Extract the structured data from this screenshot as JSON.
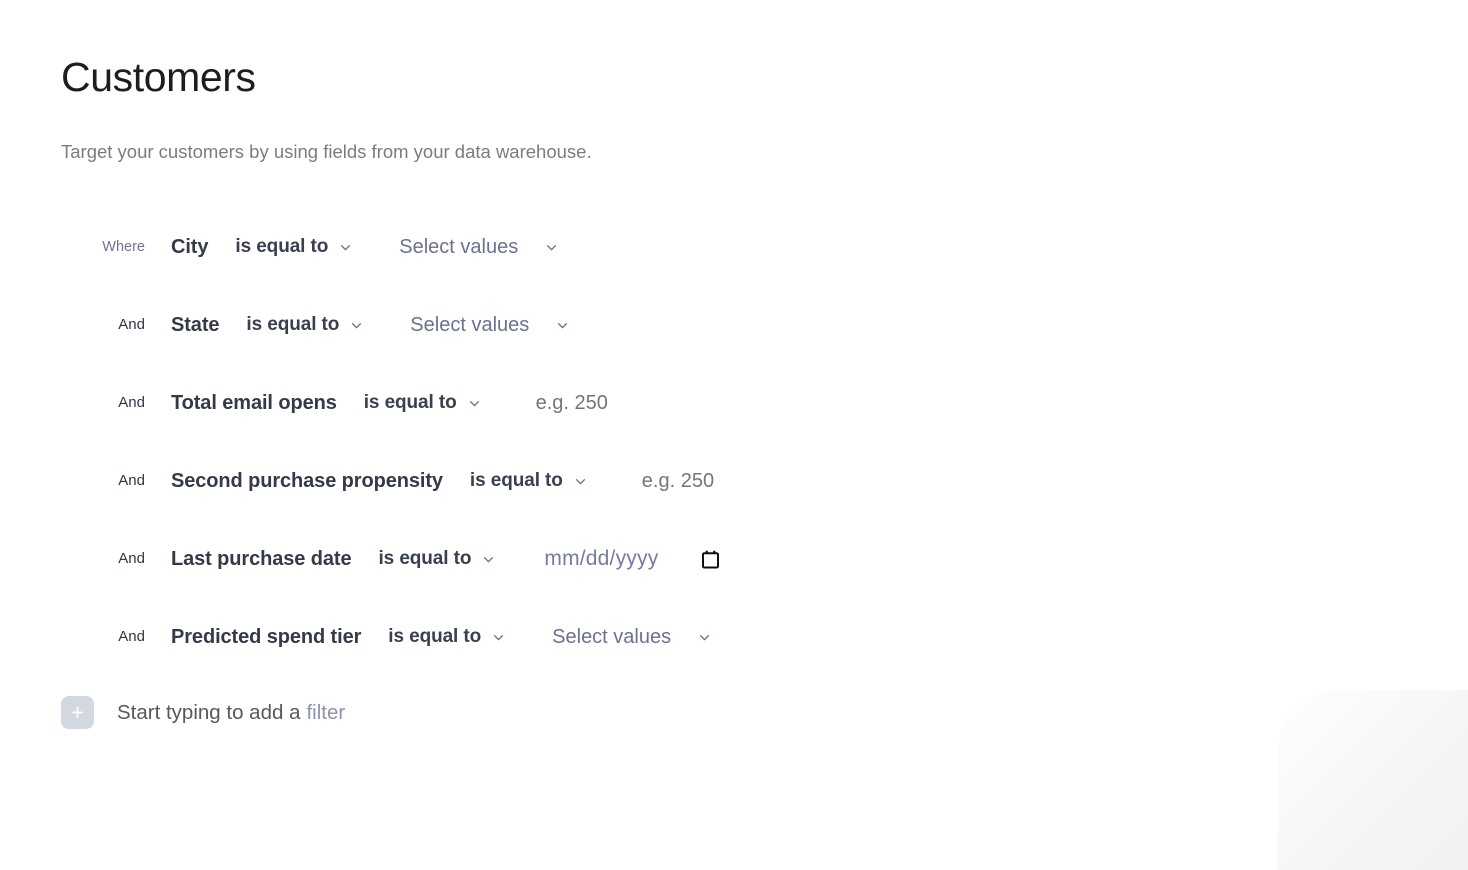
{
  "page": {
    "title": "Customers",
    "subtitle": "Target your customers by using fields from your data warehouse."
  },
  "colors": {
    "title": "#1c1c22",
    "subtitle": "#7b7b83",
    "field_name": "#343a48",
    "operator": "#3a4050",
    "where_label": "#6f7490",
    "and_label": "#2f3542",
    "select_placeholder": "#6b7190",
    "number_placeholder": "#757575",
    "date_placeholder": "#767c9b",
    "add_button_bg": "#d2d7e2",
    "chevron": "#6b7190"
  },
  "filters": [
    {
      "conjunction": "Where",
      "field": "City",
      "operator": "is equal to",
      "value_type": "select",
      "value_placeholder": "Select values",
      "operator_icon": "chevron-down-icon",
      "value_icon": "chevron-down-icon"
    },
    {
      "conjunction": "And",
      "field": "State",
      "operator": "is equal to",
      "value_type": "select",
      "value_placeholder": "Select values",
      "operator_icon": "chevron-down-icon",
      "value_icon": "chevron-down-icon"
    },
    {
      "conjunction": "And",
      "field": "Total email opens",
      "operator": "is equal to",
      "value_type": "number",
      "value_placeholder": "e.g. 250",
      "operator_icon": "chevron-down-icon",
      "value_icon": ""
    },
    {
      "conjunction": "And",
      "field": "Second purchase propensity",
      "operator": "is equal to",
      "value_type": "number",
      "value_placeholder": "e.g. 250",
      "operator_icon": "chevron-down-icon",
      "value_icon": ""
    },
    {
      "conjunction": "And",
      "field": "Last purchase date",
      "operator": "is equal to",
      "value_type": "date",
      "value_placeholder": "mm/dd/yyyy",
      "operator_icon": "chevron-down-icon",
      "value_icon": "calendar-icon"
    },
    {
      "conjunction": "And",
      "field": "Predicted spend tier",
      "operator": "is equal to",
      "value_type": "select",
      "value_placeholder": "Select values",
      "operator_icon": "chevron-down-icon",
      "value_icon": "chevron-down-icon"
    }
  ],
  "add_filter": {
    "button_icon": "plus-icon",
    "hint_prefix": "Start typing to add a",
    "hint_keyword": "filter"
  }
}
